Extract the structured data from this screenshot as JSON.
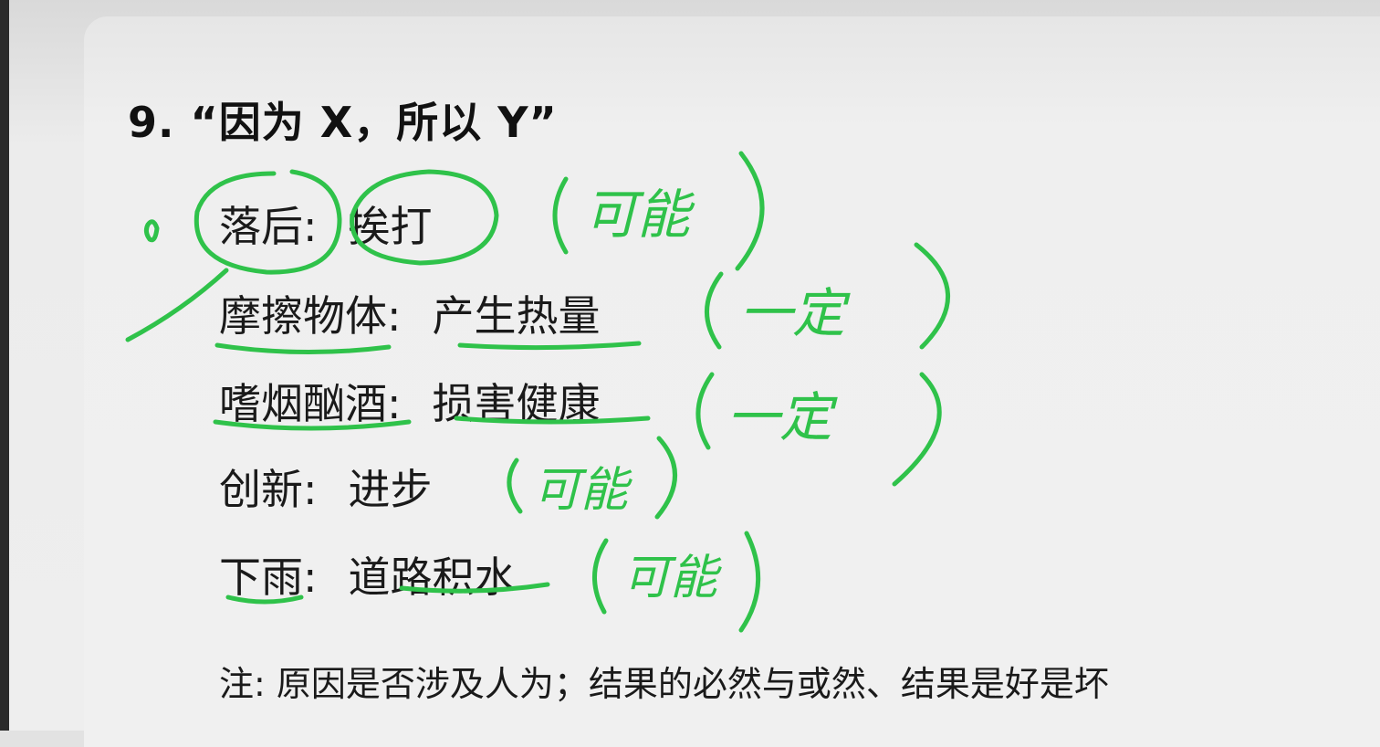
{
  "heading": "9. “因为 X，所以 Y”",
  "rows": [
    {
      "cause": "落后",
      "sep": ":",
      "effect": "挨打",
      "annotation": "可能"
    },
    {
      "cause": "摩擦物体",
      "sep": ":",
      "effect": "产生热量",
      "annotation": "一定"
    },
    {
      "cause": "嗜烟酗酒",
      "sep": ":",
      "effect": "损害健康",
      "annotation": "一定"
    },
    {
      "cause": "创新",
      "sep": ":",
      "effect": "进步",
      "annotation": "可能"
    },
    {
      "cause": "下雨",
      "sep": ":",
      "effect": "道路积水",
      "annotation": "可能"
    }
  ],
  "note": "注: 原因是否涉及人为；结果的必然与或然、结果是好是坏",
  "colors": {
    "ink": "#2fc24a",
    "text": "#1a1a1a"
  }
}
